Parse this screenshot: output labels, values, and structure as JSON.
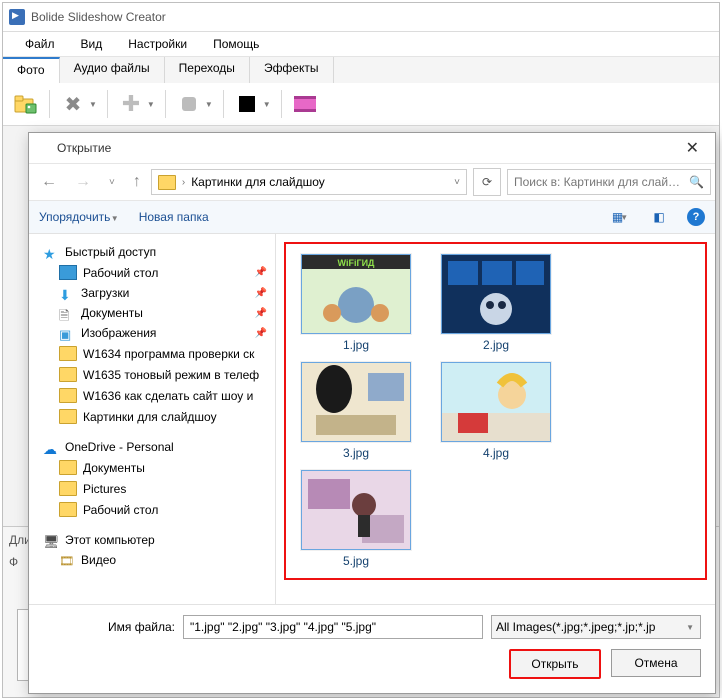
{
  "app": {
    "title": "Bolide Slideshow Creator",
    "menu": [
      "Файл",
      "Вид",
      "Настройки",
      "Помощь"
    ],
    "tabs": [
      "Фото",
      "Аудио файлы",
      "Переходы",
      "Эффекты"
    ],
    "active_tab": 0
  },
  "status": {
    "line1": "Дли",
    "line2": "Ф"
  },
  "dialog": {
    "title": "Открытие",
    "path": "Картинки для слайдшоу",
    "search_placeholder": "Поиск в: Картинки для слай…",
    "toolbar": {
      "organize": "Упорядочить",
      "new_folder": "Новая папка"
    },
    "nav": {
      "quick_access": "Быстрый доступ",
      "items_qa": [
        {
          "label": "Рабочий стол",
          "icon": "desktop",
          "pinned": true
        },
        {
          "label": "Загрузки",
          "icon": "download",
          "pinned": true
        },
        {
          "label": "Документы",
          "icon": "doc",
          "pinned": true
        },
        {
          "label": "Изображения",
          "icon": "img",
          "pinned": true
        },
        {
          "label": "W1634 программа проверки ск",
          "icon": "folder"
        },
        {
          "label": "W1635 тоновый режим в телеф",
          "icon": "folder"
        },
        {
          "label": "W1636 как сделать сайт шоу и",
          "icon": "folder"
        },
        {
          "label": "Картинки для слайдшоу",
          "icon": "folder"
        }
      ],
      "onedrive": "OneDrive - Personal",
      "items_od": [
        {
          "label": "Документы",
          "icon": "folder"
        },
        {
          "label": "Pictures",
          "icon": "folder"
        },
        {
          "label": "Рабочий стол",
          "icon": "folder"
        }
      ],
      "this_pc": "Этот компьютер",
      "items_pc": [
        {
          "label": "Видео",
          "icon": "video"
        }
      ]
    },
    "files": [
      {
        "name": "1.jpg"
      },
      {
        "name": "2.jpg"
      },
      {
        "name": "3.jpg"
      },
      {
        "name": "4.jpg"
      },
      {
        "name": "5.jpg"
      }
    ],
    "footer": {
      "filename_label": "Имя файла:",
      "filename_value": "\"1.jpg\" \"2.jpg\" \"3.jpg\" \"4.jpg\" \"5.jpg\"",
      "filter": "All Images(*.jpg;*.jpeg;*.jp;*.jp",
      "open": "Открыть",
      "cancel": "Отмена"
    }
  }
}
